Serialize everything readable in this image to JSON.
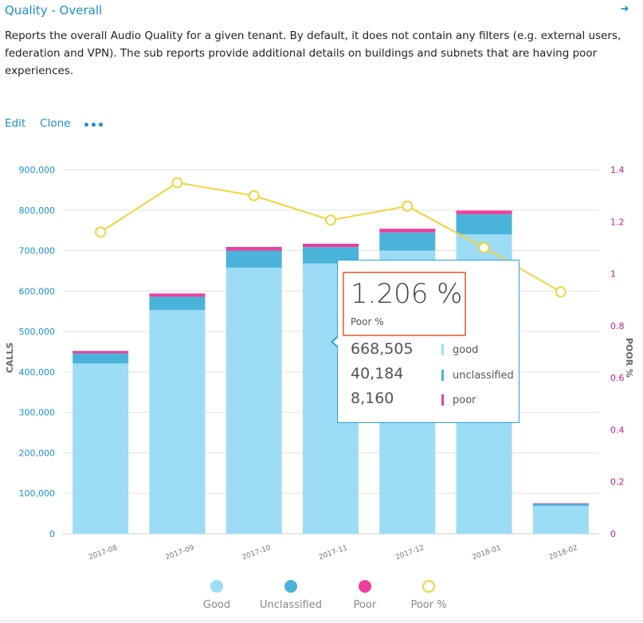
{
  "header": {
    "title": "Quality - Overall",
    "description": "Reports the overall Audio Quality for a given tenant. By default, it does not contain any filters (e.g. external users, federation and VPN). The sub reports provide additional details on buildings and subnets that are having poor experiences.",
    "arrow_icon": "arrow-right-icon"
  },
  "actions": {
    "edit": "Edit",
    "clone": "Clone",
    "more_icon": "more-icon"
  },
  "tooltip": {
    "value": "1.206 %",
    "value_label": "Poor %",
    "rows": [
      {
        "value": "668,505",
        "label": "good",
        "color": "#9ddcf5"
      },
      {
        "value": "40,184",
        "label": "unclassified",
        "color": "#4ab3d9"
      },
      {
        "value": "8,160",
        "label": "poor",
        "color": "#ec3f9c"
      }
    ]
  },
  "chart_data": {
    "type": "bar",
    "stacked": true,
    "categories": [
      "2017-08",
      "2017-09",
      "2017-10",
      "2017-11",
      "2017-12",
      "2018-01",
      "2018-02"
    ],
    "series": [
      {
        "name": "Good",
        "color": "#9ddcf5",
        "values": [
          421000,
          553000,
          658000,
          668505,
          700000,
          740000,
          69000
        ]
      },
      {
        "name": "Unclassified",
        "color": "#4ab3d9",
        "values": [
          25000,
          33000,
          42000,
          40184,
          45000,
          50000,
          5000
        ]
      },
      {
        "name": "Poor",
        "color": "#ec3f9c",
        "values": [
          6000,
          8000,
          9000,
          8160,
          9000,
          9000,
          1500
        ]
      },
      {
        "name": "Poor %",
        "color": "#f2d43a",
        "axis": "right",
        "type": "line",
        "values": [
          1.16,
          1.35,
          1.3,
          1.206,
          1.26,
          1.1,
          0.93
        ]
      }
    ],
    "ylabel": "CALLS",
    "y2label": "POOR %",
    "ylim": [
      0,
      900000
    ],
    "y2lim": [
      0,
      1.4
    ],
    "yticks": [
      "0",
      "100,000",
      "200,000",
      "300,000",
      "400,000",
      "500,000",
      "600,000",
      "700,000",
      "800,000",
      "900,000"
    ],
    "y2ticks": [
      "0",
      "0.2",
      "0.4",
      "0.6",
      "0.8",
      "1",
      "1.2",
      "1.4"
    ],
    "grid": true,
    "legend": "bottom",
    "highlight_index": 3
  }
}
